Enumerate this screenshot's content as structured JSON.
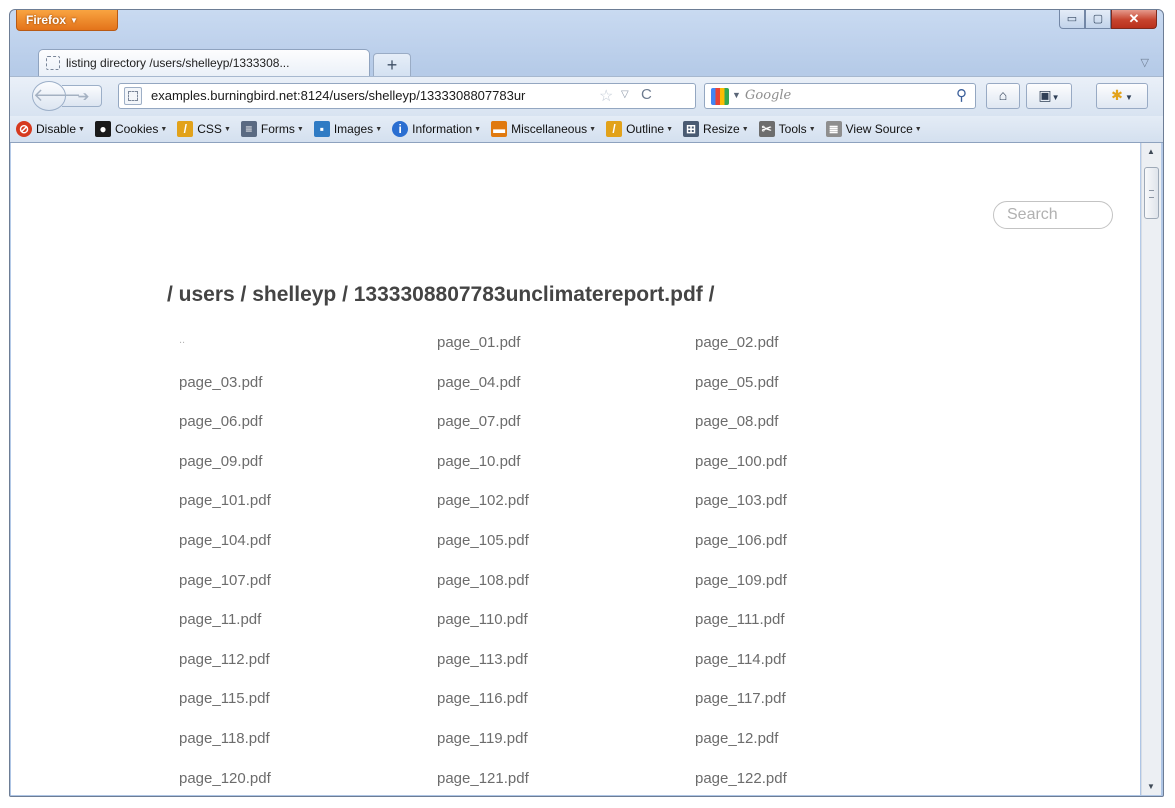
{
  "browser": {
    "menu_button": "Firefox",
    "window_controls": {
      "minimize": "▭",
      "maximize": "▢",
      "close": "✕"
    },
    "tab_title": "listing directory /users/shelleyp/1333308...",
    "new_tab": "+",
    "url": "examples.burningbird.net:8124/users/shelleyp/1333308807783ur",
    "search_placeholder": "Google"
  },
  "toolbar": {
    "items": [
      {
        "label": "Disable",
        "icon": "no-entry-icon",
        "color": "#d63a1f"
      },
      {
        "label": "Cookies",
        "icon": "person-icon",
        "color": "#1a1a1a"
      },
      {
        "label": "CSS",
        "icon": "wand-icon",
        "color": "#e2a21a"
      },
      {
        "label": "Forms",
        "icon": "form-icon",
        "color": "#5a6a82"
      },
      {
        "label": "Images",
        "icon": "image-icon",
        "color": "#2f7bc4"
      },
      {
        "label": "Information",
        "icon": "info-icon",
        "color": "#2a6ed1"
      },
      {
        "label": "Miscellaneous",
        "icon": "box-icon",
        "color": "#e07a10"
      },
      {
        "label": "Outline",
        "icon": "pencil-icon",
        "color": "#e2a21a"
      },
      {
        "label": "Resize",
        "icon": "resize-icon",
        "color": "#4a5b72"
      },
      {
        "label": "Tools",
        "icon": "tools-icon",
        "color": "#6d6d6d"
      },
      {
        "label": "View Source",
        "icon": "document-icon",
        "color": "#8e8e8e"
      }
    ]
  },
  "page": {
    "search_placeholder": "Search",
    "title": "/ users / shelleyp / 1333308807783unclimatereport.pdf /",
    "files": [
      "..",
      "page_01.pdf",
      "page_02.pdf",
      "page_03.pdf",
      "page_04.pdf",
      "page_05.pdf",
      "page_06.pdf",
      "page_07.pdf",
      "page_08.pdf",
      "page_09.pdf",
      "page_10.pdf",
      "page_100.pdf",
      "page_101.pdf",
      "page_102.pdf",
      "page_103.pdf",
      "page_104.pdf",
      "page_105.pdf",
      "page_106.pdf",
      "page_107.pdf",
      "page_108.pdf",
      "page_109.pdf",
      "page_11.pdf",
      "page_110.pdf",
      "page_111.pdf",
      "page_112.pdf",
      "page_113.pdf",
      "page_114.pdf",
      "page_115.pdf",
      "page_116.pdf",
      "page_117.pdf",
      "page_118.pdf",
      "page_119.pdf",
      "page_12.pdf",
      "page_120.pdf",
      "page_121.pdf",
      "page_122.pdf"
    ]
  }
}
